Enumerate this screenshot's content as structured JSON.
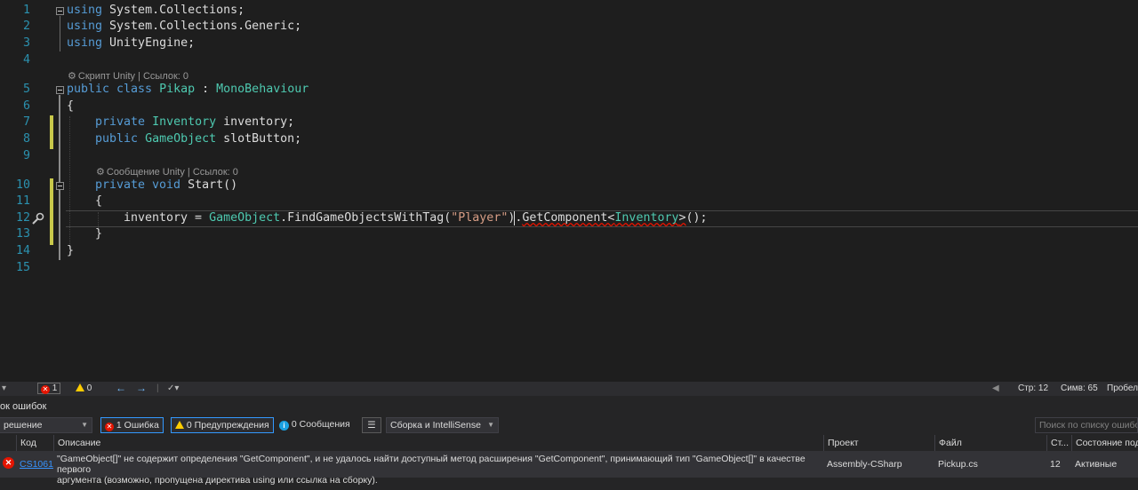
{
  "editor": {
    "line_numbers": [
      "1",
      "2",
      "3",
      "4",
      "5",
      "6",
      "7",
      "8",
      "9",
      "10",
      "11",
      "12",
      "13",
      "14",
      "15"
    ],
    "code": {
      "l1_kw": "using",
      "l1_rest": " System.Collections;",
      "l2_kw": "using",
      "l2_rest": " System.Collections.Generic;",
      "l3_kw": "using",
      "l3_rest": " UnityEngine;",
      "lens1": "Скрипт Unity | Ссылок: 0",
      "l5_kw": "public class",
      "l5_sp": " ",
      "l5_name": "Pikap",
      "l5_colon": " : ",
      "l5_base": "MonoBehaviour",
      "l6": "{",
      "l7_kw": "private",
      "l7_type": "Inventory",
      "l7_rest": " inventory;",
      "l8_kw": "public",
      "l8_type": "GameObject",
      "l8_rest": " slotButton;",
      "lens2": "Сообщение Unity | Ссылок: 0",
      "l10_kw": "private void",
      "l10_rest": " Start()",
      "l11": "{",
      "l12_a": "inventory = ",
      "l12_type1": "GameObject",
      "l12_b": ".FindGameObjectsWithTag(",
      "l12_str": "\"Player\"",
      "l12_c": ").",
      "l12_err": "GetComponent<",
      "l12_type2": "Inventory",
      "l12_err2": ">",
      "l12_d": "();",
      "l13": "}",
      "l14": "}"
    }
  },
  "status_strip": {
    "errors": "1",
    "warnings": "0",
    "line": "Стр: 12",
    "col": "Симв: 65",
    "spaces": "Пробел"
  },
  "error_list": {
    "title": "ок ошибок",
    "scope": "решение",
    "filter_errors": "1 Ошибка",
    "filter_warnings": "0 Предупреждения",
    "filter_messages": "0 Сообщения",
    "build_source": "Сборка и IntelliSense",
    "search_placeholder": "Поиск по списку ошибок",
    "columns": {
      "code": "Код",
      "description": "Описание",
      "project": "Проект",
      "file": "Файл",
      "line": "Ст...",
      "state": "Состояние под"
    },
    "rows": [
      {
        "code": "CS1061",
        "description_1": "\"GameObject[]\" не содержит определения \"GetComponent\", и не удалось найти доступный метод расширения \"GetComponent\", принимающий тип \"GameObject[]\" в качестве первого",
        "description_2": "аргумента (возможно, пропущена директива using или ссылка на сборку).",
        "project": "Assembly-CSharp",
        "file": "Pickup.cs",
        "line": "12",
        "state": "Активные"
      }
    ]
  },
  "colors": {
    "keyword": "#569cd6",
    "type": "#4ec9b0",
    "string": "#d69d85",
    "line_number": "#2b91af",
    "error": "#e51400"
  },
  "icons": [
    "collapse-icon",
    "quick-action-icon",
    "error-icon",
    "warning-icon",
    "info-icon",
    "nav-back-icon",
    "nav-forward-icon",
    "filter-icon"
  ]
}
